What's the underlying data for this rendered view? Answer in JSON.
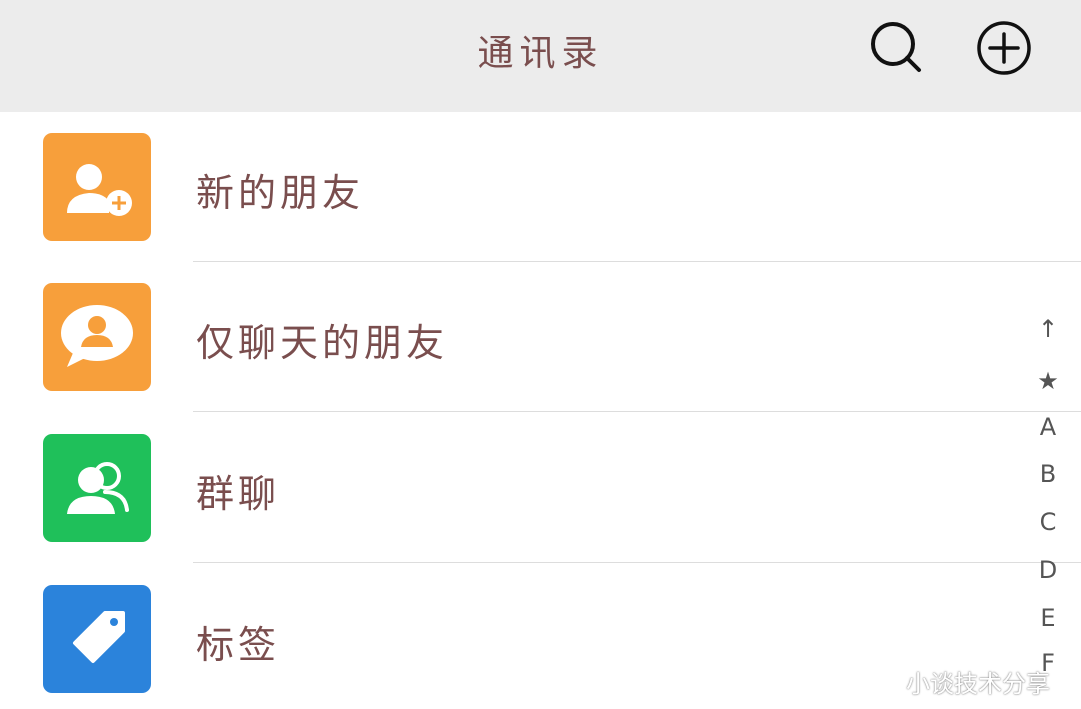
{
  "header": {
    "title": "通讯录",
    "search_icon": "search-icon",
    "add_icon": "add-circle-icon"
  },
  "rows": [
    {
      "label": "新的朋友",
      "icon": "add-friend-icon",
      "color": "#f79f3b"
    },
    {
      "label": "仅聊天的朋友",
      "icon": "chat-only-friend-icon",
      "color": "#f79f3b"
    },
    {
      "label": "群聊",
      "icon": "group-chat-icon",
      "color": "#1fc05a"
    },
    {
      "label": "标签",
      "icon": "tag-icon",
      "color": "#2b83db"
    }
  ],
  "index_bar": [
    "↑",
    "★",
    "A",
    "B",
    "C",
    "D",
    "E",
    "F"
  ],
  "watermark": "小谈技术分享"
}
